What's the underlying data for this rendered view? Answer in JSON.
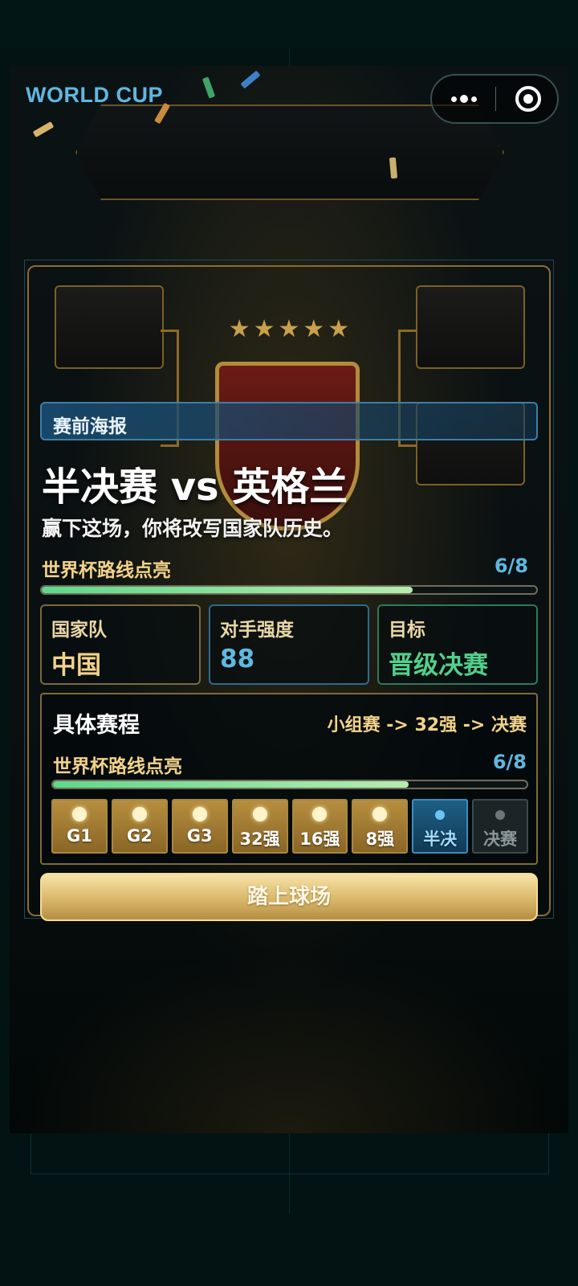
{
  "header": {
    "brand": "WORLD CUP",
    "more_icon": "more-dots-icon",
    "close_icon": "target-circle-icon"
  },
  "poster": {
    "tag": "赛前海报",
    "title": "半决赛 vs 英格兰",
    "subtitle": "赢下这场，你将改写国家队历史。",
    "route_label": "世界杯路线点亮",
    "route_count": "6/8",
    "progress": 0.75
  },
  "stats": [
    {
      "label": "国家队",
      "value": "中国",
      "color": "#f3d38a"
    },
    {
      "label": "对手强度",
      "value": "88",
      "color": "#5fb8e0"
    },
    {
      "label": "目标",
      "value": "晋级决赛",
      "color": "#52d08a"
    }
  ],
  "schedule": {
    "title": "具体赛程",
    "path": "小组赛 -> 32强 -> 决赛",
    "route_label": "世界杯路线点亮",
    "route_count": "6/8",
    "progress": 0.75,
    "stages": [
      {
        "label": "G1",
        "state": "done"
      },
      {
        "label": "G2",
        "state": "done"
      },
      {
        "label": "G3",
        "state": "done"
      },
      {
        "label": "32强",
        "state": "done"
      },
      {
        "label": "16强",
        "state": "done"
      },
      {
        "label": "8强",
        "state": "done"
      },
      {
        "label": "半决",
        "state": "current"
      },
      {
        "label": "决赛",
        "state": "locked"
      }
    ]
  },
  "cta": {
    "label": "踏上球场"
  },
  "colors": {
    "accent_gold": "#d9b86a",
    "accent_blue": "#5fb8e0",
    "accent_green": "#52d08a"
  }
}
